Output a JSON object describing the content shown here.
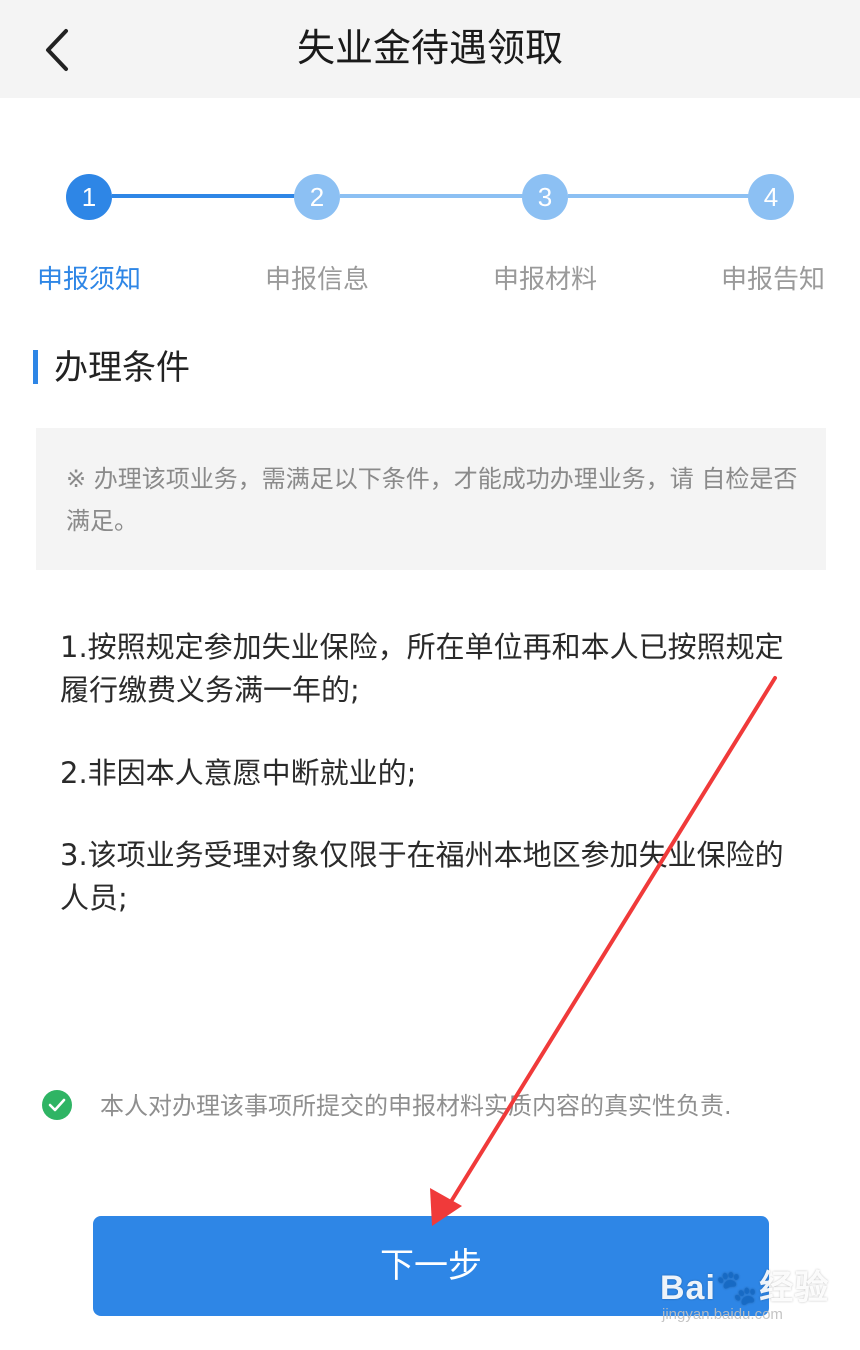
{
  "header": {
    "title": "失业金待遇领取",
    "back_icon": "chevron-left-icon"
  },
  "stepper": {
    "active_color": "#2e86e6",
    "inactive_color": "#8cc0f3",
    "steps": [
      {
        "number": "1",
        "label": "申报须知",
        "active": true
      },
      {
        "number": "2",
        "label": "申报信息",
        "active": false
      },
      {
        "number": "3",
        "label": "申报材料",
        "active": false
      },
      {
        "number": "4",
        "label": "申报告知",
        "active": false
      }
    ]
  },
  "section": {
    "title": "办理条件"
  },
  "notice": {
    "text": "※ 办理该项业务，需满足以下条件，才能成功办理业务，请 自检是否满足。"
  },
  "conditions": [
    "1.按照规定参加失业保险，所在单位再和本人已按照规定履行缴费义务满一年的;",
    "2.非因本人意愿中断就业的;",
    "3.该项业务受理对象仅限于在福州本地区参加失业保险的人员;"
  ],
  "agreement": {
    "checked": true,
    "text": "本人对办理该事项所提交的申报材料实质内容的真实性负责."
  },
  "footer": {
    "next_label": "下一步"
  },
  "watermark": {
    "logo": "Bai🐾经验",
    "sub": "jingyan.baidu.com"
  },
  "annotation": {
    "color": "#f03a3a"
  }
}
